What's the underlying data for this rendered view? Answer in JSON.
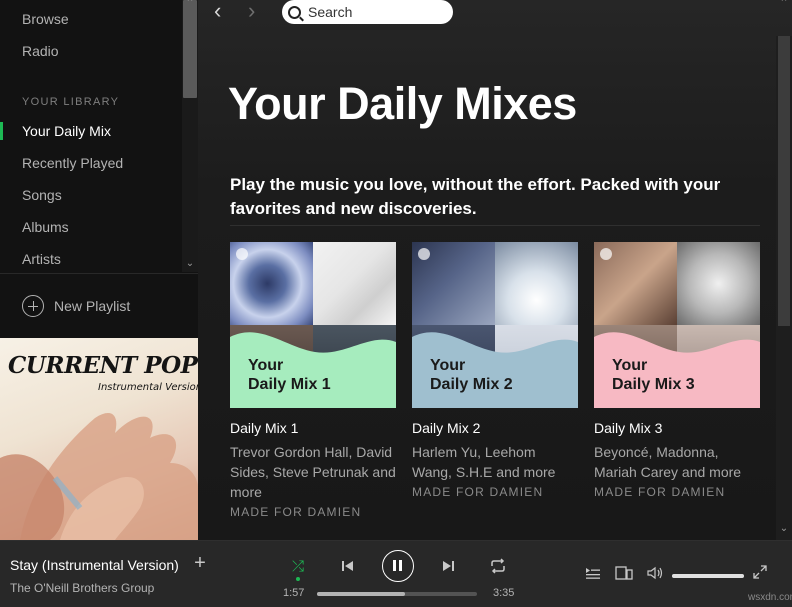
{
  "sidebar": {
    "nav": [
      {
        "label": "Browse"
      },
      {
        "label": "Radio"
      }
    ],
    "library_heading": "YOUR LIBRARY",
    "library": [
      {
        "label": "Your Daily Mix",
        "active": true
      },
      {
        "label": "Recently Played"
      },
      {
        "label": "Songs"
      },
      {
        "label": "Albums"
      },
      {
        "label": "Artists"
      }
    ],
    "new_playlist": "New Playlist"
  },
  "album_art": {
    "title": "CURRENT POP HITS",
    "subtitle": "Instrumental Versions"
  },
  "toolbar": {
    "search_placeholder": "Search"
  },
  "main": {
    "title": "Your Daily Mixes",
    "description": "Play the music you love, without the effort. Packed with your favorites and new discoveries.",
    "cards": [
      {
        "cover_label": "Your\nDaily Mix 1",
        "title": "Daily Mix 1",
        "description": "Trevor Gordon Hall, David Sides, Steve Petrunak and more",
        "meta": "MADE FOR DAMIEN",
        "wave_color": "#a6ecbe"
      },
      {
        "cover_label": "Your\nDaily Mix 2",
        "title": "Daily Mix 2",
        "description": "Harlem Yu, Leehom Wang, S.H.E and more",
        "meta": "MADE FOR DAMIEN",
        "wave_color": "#9fbfcf"
      },
      {
        "cover_label": "Your\nDaily Mix 3",
        "title": "Daily Mix 3",
        "description": "Beyoncé, Madonna, Mariah Carey and more",
        "meta": "MADE FOR DAMIEN",
        "wave_color": "#f7b9c3"
      }
    ]
  },
  "player": {
    "track": "Stay (Instrumental Version)",
    "artist": "The O'Neill Brothers Group",
    "elapsed": "1:57",
    "total": "3:35",
    "progress_fraction": 0.55,
    "volume_fraction": 1.0,
    "shuffle_active": true
  },
  "colors": {
    "accent": "#1db954",
    "background": "#121212"
  },
  "watermark": "wsxdn.com"
}
